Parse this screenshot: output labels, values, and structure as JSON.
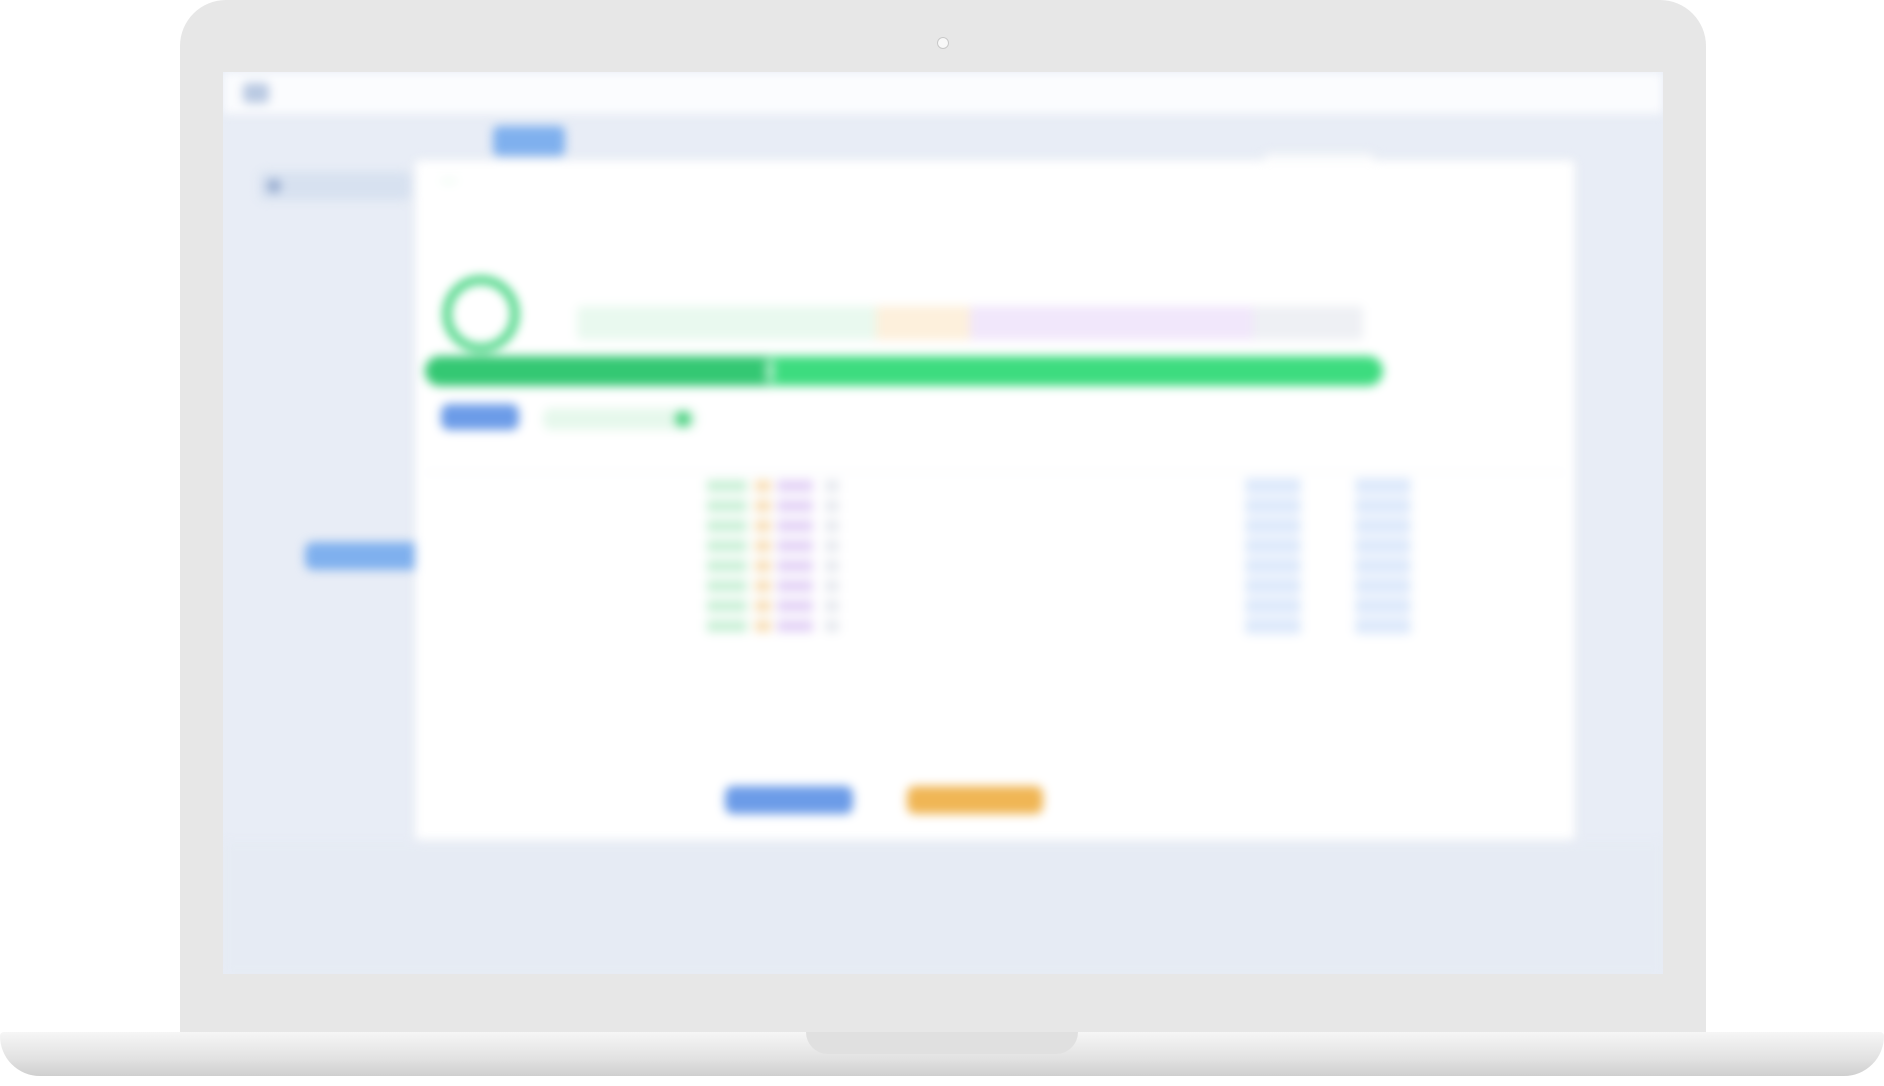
{
  "app": {
    "logo_text": "",
    "window_title": "",
    "menu": [
      "",
      "",
      "",
      ""
    ]
  },
  "toolbar": {
    "buttons": [
      "",
      "",
      "",
      ""
    ],
    "active_index": 3,
    "right_dropdown": "",
    "right_link": ""
  },
  "sidebar": {
    "head_label": "",
    "sub_label": "",
    "action_button": ""
  },
  "task": {
    "description": "",
    "status": "",
    "meta": "",
    "meta_dim": "",
    "section_left": "",
    "section_right": ""
  },
  "gauge": {
    "value_percent": 100,
    "label": ""
  },
  "segments": {
    "legend": [
      "",
      "",
      "",
      ""
    ],
    "items": [
      {
        "label": "",
        "fraction": 0.38,
        "color": "#e9f9ef",
        "text_color": "#6cbc8a"
      },
      {
        "label": "",
        "fraction": 0.12,
        "color": "#fdf0dc",
        "text_color": "#d9a04d"
      },
      {
        "label": "",
        "fraction": 0.36,
        "color": "#f1e7fb",
        "text_color": "#a57ad8"
      },
      {
        "label": "",
        "fraction": 0.14,
        "color": "#eef0f4",
        "text_color": "#8f98a6"
      }
    ]
  },
  "progress": {
    "fraction": 0.36,
    "color": "#3ddc7f"
  },
  "actions": {
    "primary": "",
    "secondary": ""
  },
  "table": {
    "columns": [
      "",
      "",
      "",
      "",
      "",
      ""
    ],
    "rows": [
      {
        "name": "",
        "value": "",
        "chip_a": "",
        "chip_b": ""
      },
      {
        "name": "",
        "value": "",
        "chip_a": "",
        "chip_b": ""
      },
      {
        "name": "",
        "value": "",
        "chip_a": "",
        "chip_b": ""
      },
      {
        "name": "",
        "value": "",
        "chip_a": "",
        "chip_b": ""
      },
      {
        "name": "",
        "value": "",
        "chip_a": "",
        "chip_b": ""
      },
      {
        "name": "",
        "value": "",
        "chip_a": "",
        "chip_b": ""
      },
      {
        "name": "",
        "value": "",
        "chip_a": "",
        "chip_b": ""
      },
      {
        "name": "",
        "value": "",
        "chip_a": "",
        "chip_b": ""
      }
    ]
  },
  "footer": {
    "note": "",
    "blue_button": "",
    "orange_button": ""
  }
}
